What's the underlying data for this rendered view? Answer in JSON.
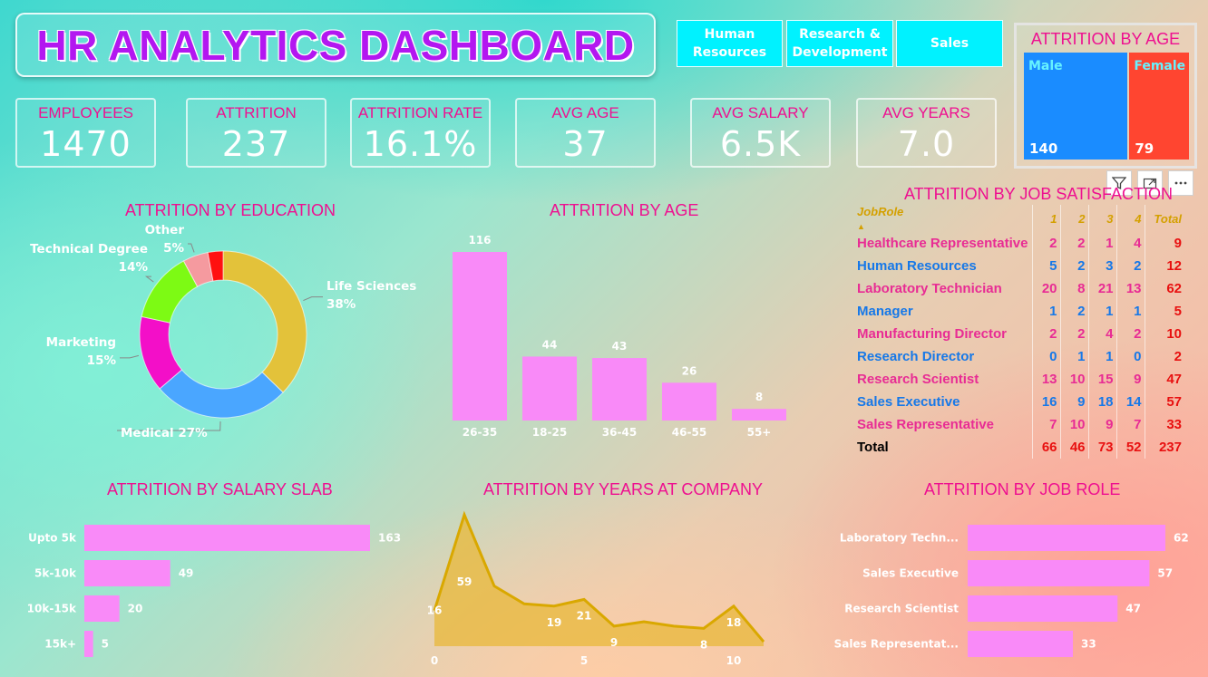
{
  "header": {
    "title": "HR ANALYTICS DASHBOARD",
    "departments": [
      "Human Resources",
      "Research & Development",
      "Sales"
    ]
  },
  "kpis": [
    {
      "label": "EMPLOYEES",
      "value": "1470"
    },
    {
      "label": "ATTRITION",
      "value": "237"
    },
    {
      "label": "ATTRITION RATE",
      "value": "16.1%"
    },
    {
      "label": "AVG AGE",
      "value": "37"
    },
    {
      "label": "AVG SALARY",
      "value": "6.5K"
    },
    {
      "label": "AVG YEARS",
      "value": "7.0"
    }
  ],
  "colors": {
    "accent_pink": "#ee1090",
    "title_purple": "#b317f0",
    "button_cyan": "#00f2ff",
    "bar_pink": "#f98af8",
    "male_blue": "#1a8cff",
    "female_red": "#ff4530",
    "area_fill": "#e8b83a"
  },
  "chart_data": [
    {
      "id": "gender",
      "type": "treemap",
      "title": "ATTRITION BY AGE",
      "categories": [
        "Male",
        "Female"
      ],
      "values": [
        140,
        79
      ],
      "colors": [
        "#1a8cff",
        "#ff4530"
      ],
      "label_colors": [
        "#66f2ff",
        "#66f2ff"
      ]
    },
    {
      "id": "education",
      "type": "pie",
      "title": "ATTRITION BY EDUCATION",
      "categories": [
        "Life Sciences",
        "Medical",
        "Marketing",
        "Technical Degree",
        "Other",
        ""
      ],
      "values": [
        38,
        27,
        15,
        14,
        5,
        3
      ],
      "labels": [
        "Life Sciences\n38%",
        "Medical 27%",
        "Marketing\n15%",
        "Technical Degree\n14%",
        "Other\n5%",
        ""
      ],
      "colors": [
        "#e3c23a",
        "#4aa6ff",
        "#f30fc8",
        "#7dfa14",
        "#f59a9f",
        "#ff1010"
      ]
    },
    {
      "id": "age",
      "type": "bar",
      "title": "ATTRITION BY AGE",
      "categories": [
        "26-35",
        "18-25",
        "36-45",
        "46-55",
        "55+"
      ],
      "values": [
        116,
        44,
        43,
        26,
        8
      ]
    },
    {
      "id": "salary",
      "type": "bar",
      "orientation": "horizontal",
      "title": "ATTRITION BY SALARY SLAB",
      "categories": [
        "Upto 5k",
        "5k-10k",
        "10k-15k",
        "15k+"
      ],
      "values": [
        163,
        49,
        20,
        5
      ]
    },
    {
      "id": "years",
      "type": "area",
      "title": "ATTRITION BY YEARS AT COMPANY",
      "x": [
        0,
        1,
        2,
        3,
        4,
        5,
        6,
        7,
        8,
        9,
        10,
        11
      ],
      "y": [
        16,
        59,
        27,
        19,
        18,
        21,
        9,
        11,
        9,
        8,
        18,
        2
      ],
      "point_labels": {
        "0": "16",
        "1": "59",
        "4": "19",
        "5": "21",
        "6": "9",
        "9": "8",
        "10": "18"
      },
      "xticks": [
        0,
        5,
        10
      ]
    },
    {
      "id": "jobrole",
      "type": "bar",
      "orientation": "horizontal",
      "title": "ATTRITION BY JOB ROLE",
      "categories": [
        "Laboratory Techn...",
        "Sales Executive",
        "Research Scientist",
        "Sales Representat..."
      ],
      "values": [
        62,
        57,
        47,
        33
      ]
    }
  ],
  "job_satisfaction": {
    "title": "ATTRITION BY JOB SATISFACTION",
    "headers": [
      "JobRole",
      "1",
      "2",
      "3",
      "4",
      "Total"
    ],
    "rows": [
      {
        "role": "Healthcare Representative",
        "v": [
          2,
          2,
          1,
          4
        ],
        "total": 9
      },
      {
        "role": "Human Resources",
        "v": [
          5,
          2,
          3,
          2
        ],
        "total": 12
      },
      {
        "role": "Laboratory Technician",
        "v": [
          20,
          8,
          21,
          13
        ],
        "total": 62
      },
      {
        "role": "Manager",
        "v": [
          1,
          2,
          1,
          1
        ],
        "total": 5
      },
      {
        "role": "Manufacturing Director",
        "v": [
          2,
          2,
          4,
          2
        ],
        "total": 10
      },
      {
        "role": "Research Director",
        "v": [
          0,
          1,
          1,
          0
        ],
        "total": 2
      },
      {
        "role": "Research Scientist",
        "v": [
          13,
          10,
          15,
          9
        ],
        "total": 47
      },
      {
        "role": "Sales Executive",
        "v": [
          16,
          9,
          18,
          14
        ],
        "total": 57
      },
      {
        "role": "Sales Representative",
        "v": [
          7,
          10,
          9,
          7
        ],
        "total": 33
      }
    ],
    "footer": {
      "label": "Total",
      "v": [
        66,
        46,
        73,
        52
      ],
      "total": 237
    }
  }
}
